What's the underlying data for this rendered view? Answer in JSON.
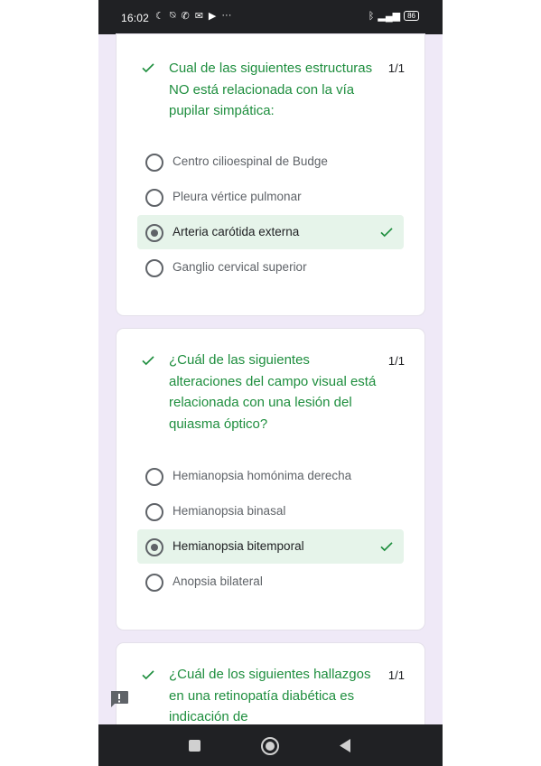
{
  "status_bar": {
    "time": "16:02",
    "notification_icons": [
      "moon-icon",
      "mute-icon",
      "whatsapp-icon",
      "chat-icon",
      "youtube-icon"
    ],
    "overflow": "···",
    "battery_level": "86"
  },
  "colors": {
    "correct_green": "#1e8e3e",
    "selected_bg": "#e6f4ea",
    "page_bg": "#efe9f7"
  },
  "questions": [
    {
      "text": "Cual de las siguientes estructuras NO está relacionada con la vía pupilar simpática:",
      "score": "1/1",
      "options": [
        "Centro cilioespinal de Budge",
        "Pleura vértice pulmonar",
        "Arteria carótida externa",
        "Ganglio cervical superior"
      ],
      "selected_index": 2
    },
    {
      "text": "¿Cuál de las siguientes alteraciones del campo visual está relacionada con una lesión del quiasma óptico?",
      "score": "1/1",
      "options": [
        "Hemianopsia homónima derecha",
        "Hemianopsia binasal",
        "Hemianopsia bitemporal",
        "Anopsia bilateral"
      ],
      "selected_index": 2
    },
    {
      "text": "¿Cuál de los siguientes hallazgos en una retinopatía diabética es indicación de",
      "score": "1/1"
    }
  ]
}
